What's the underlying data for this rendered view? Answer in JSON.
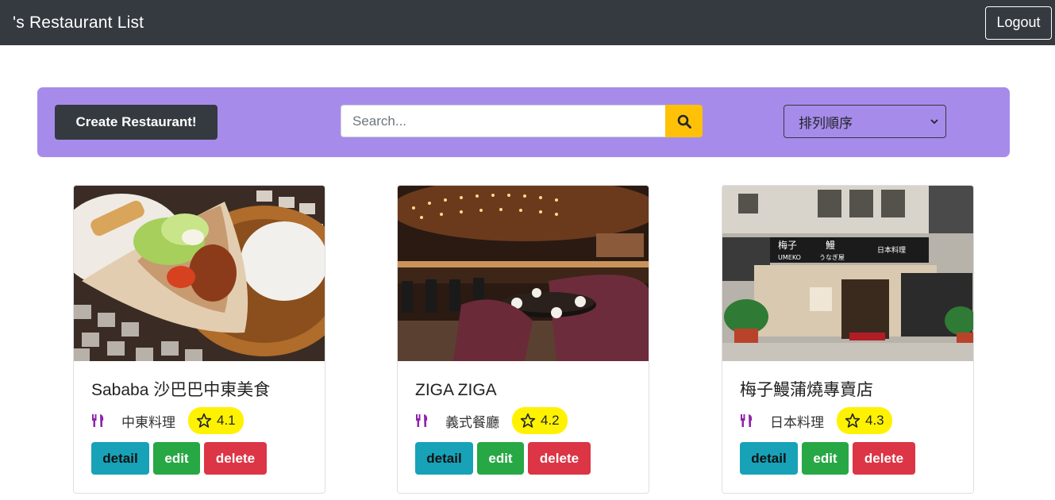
{
  "navbar": {
    "brand": "'s Restaurant List",
    "logout_label": "Logout"
  },
  "toolbar": {
    "create_label": "Create Restaurant!",
    "search_placeholder": "Search...",
    "sort_label": "排列順序"
  },
  "colors": {
    "toolbar_bg": "#a78bea",
    "detail": "#17a2b8",
    "edit": "#28a745",
    "delete": "#dc3545",
    "rating_bg": "#fff200",
    "icon": "#8e24aa"
  },
  "restaurants": [
    {
      "name": "Sababa 沙巴巴中東美食",
      "category": "中東料理",
      "rating": "4.1",
      "detail": "detail",
      "edit": "edit",
      "delete": "delete"
    },
    {
      "name": "ZIGA ZIGA",
      "category": "義式餐廳",
      "rating": "4.2",
      "detail": "detail",
      "edit": "edit",
      "delete": "delete"
    },
    {
      "name": "梅子鰻蒲燒專賣店",
      "category": "日本料理",
      "rating": "4.3",
      "detail": "detail",
      "edit": "edit",
      "delete": "delete"
    }
  ],
  "sign_text": {
    "line1": "梅子",
    "line2": "UMEKO",
    "line3": "鰻",
    "line4": "うなぎ屋",
    "line5": "日本料理"
  }
}
